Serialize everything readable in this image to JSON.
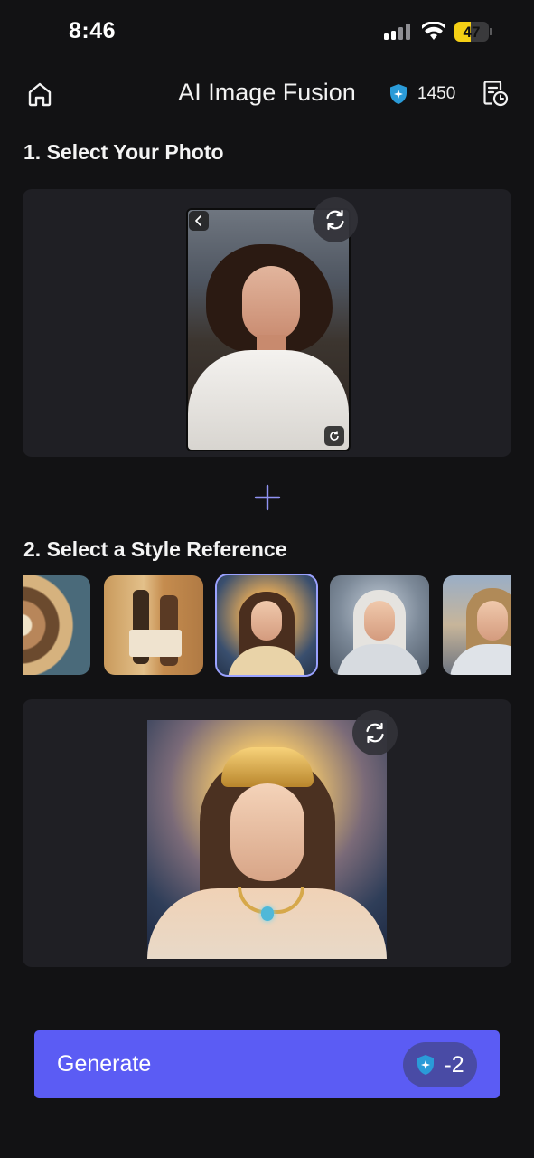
{
  "status_bar": {
    "time": "8:46",
    "battery_level": "47",
    "battery_fraction": 0.47
  },
  "header": {
    "title": "AI Image Fusion",
    "credits": "1450",
    "icons": [
      "home-icon",
      "credit-shield-icon",
      "history-icon"
    ]
  },
  "section1": {
    "title": "1. Select Your Photo"
  },
  "section2": {
    "title": "2. Select a Style Reference",
    "styles": [
      {
        "name": "style-dome"
      },
      {
        "name": "style-egyptian"
      },
      {
        "name": "style-goddess",
        "selected": true
      },
      {
        "name": "style-silver-knight"
      },
      {
        "name": "style-warrior"
      }
    ]
  },
  "generate": {
    "label": "Generate",
    "cost": "-2"
  },
  "colors": {
    "background": "#121214",
    "panel": "#1f1f24",
    "accent": "#5b5cf4",
    "selected_outline": "#9aa2ff",
    "battery": "#f5d015"
  }
}
